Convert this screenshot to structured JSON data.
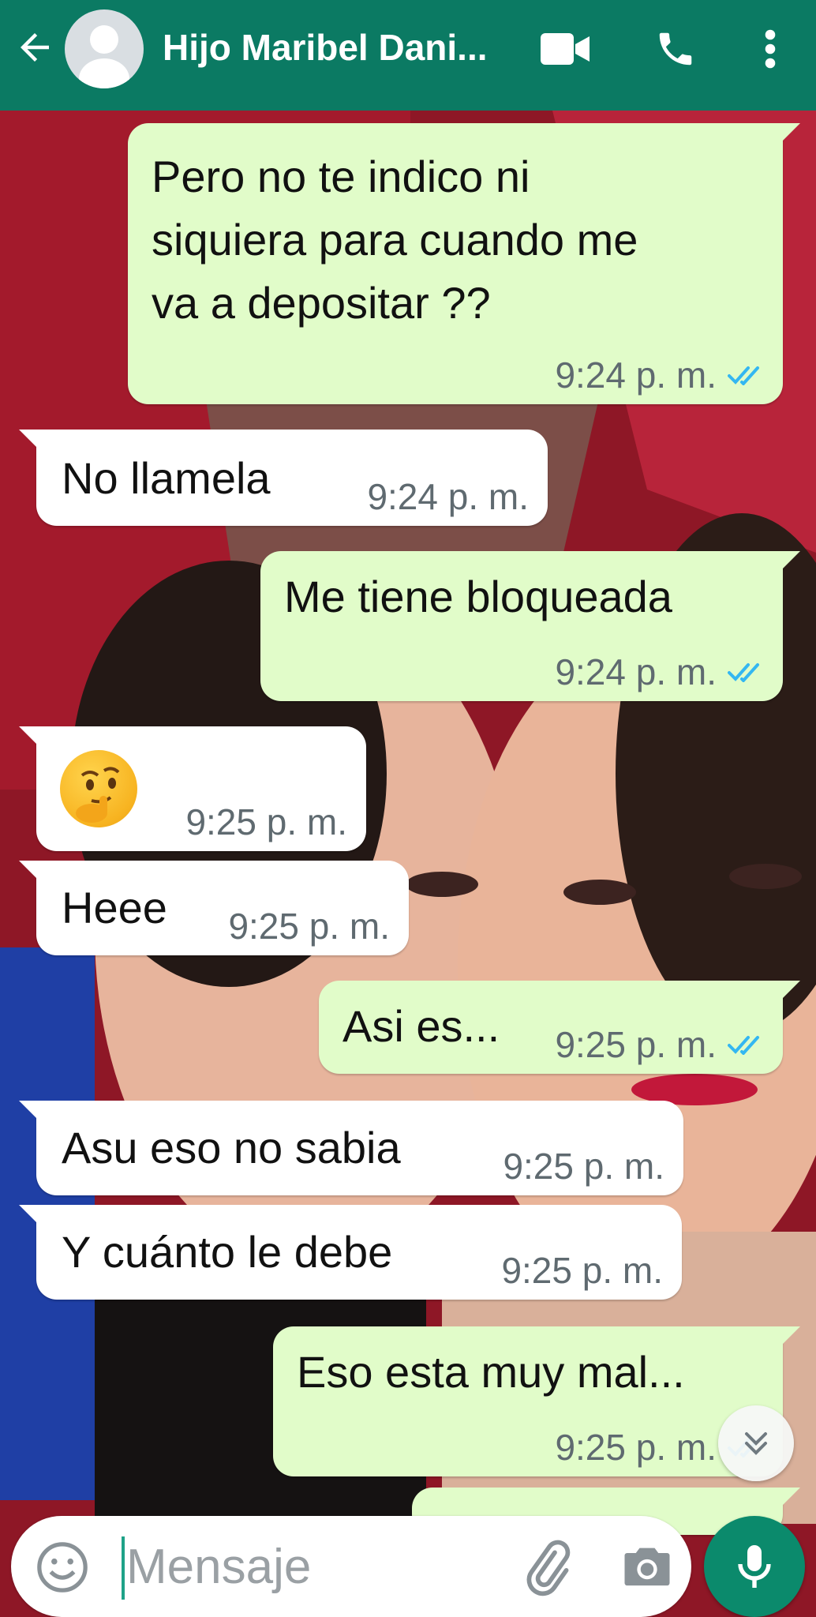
{
  "colors": {
    "header_bg": "#0b7a63",
    "incoming_bubble": "#ffffff",
    "outgoing_bubble": "#e1fcc9",
    "read_ticks": "#34b7f1",
    "mic_button": "#0b8a6c"
  },
  "header": {
    "title": "Hijo Maribel Dani...",
    "icons": {
      "back": "arrow-left-icon",
      "avatar": "default-avatar-icon",
      "video": "videocam-icon",
      "call": "phone-icon",
      "menu": "more-vert-icon"
    }
  },
  "messages": [
    {
      "direction": "out",
      "text": "Pero no te indico ni\nsiquiera para cuando me\nva a depositar ??",
      "time": "9:24 p. m.",
      "status": "read"
    },
    {
      "direction": "in",
      "text": "No llamela",
      "time": "9:24 p. m."
    },
    {
      "direction": "out",
      "text": "Me tiene bloqueada",
      "time": "9:24 p. m.",
      "status": "read"
    },
    {
      "direction": "in",
      "emoji": "thinking-face-emoji",
      "time": "9:25 p. m."
    },
    {
      "direction": "in",
      "text": "Heee",
      "time": "9:25 p. m."
    },
    {
      "direction": "out",
      "text": "Asi es...",
      "time": "9:25 p. m.",
      "status": "read"
    },
    {
      "direction": "in",
      "text": "Asu eso no sabia",
      "time": "9:25 p. m."
    },
    {
      "direction": "in",
      "text": "Y cuánto le debe",
      "time": "9:25 p. m."
    },
    {
      "direction": "out",
      "text": "Eso esta muy mal...",
      "time": "9:25 p. m.",
      "status": "read"
    }
  ],
  "scroll_down_icon": "double-chevron-down-icon",
  "composer": {
    "placeholder": "Mensaje",
    "icons": {
      "emoji": "emoji-icon",
      "attach": "paperclip-icon",
      "camera": "camera-icon",
      "mic": "mic-icon"
    }
  }
}
